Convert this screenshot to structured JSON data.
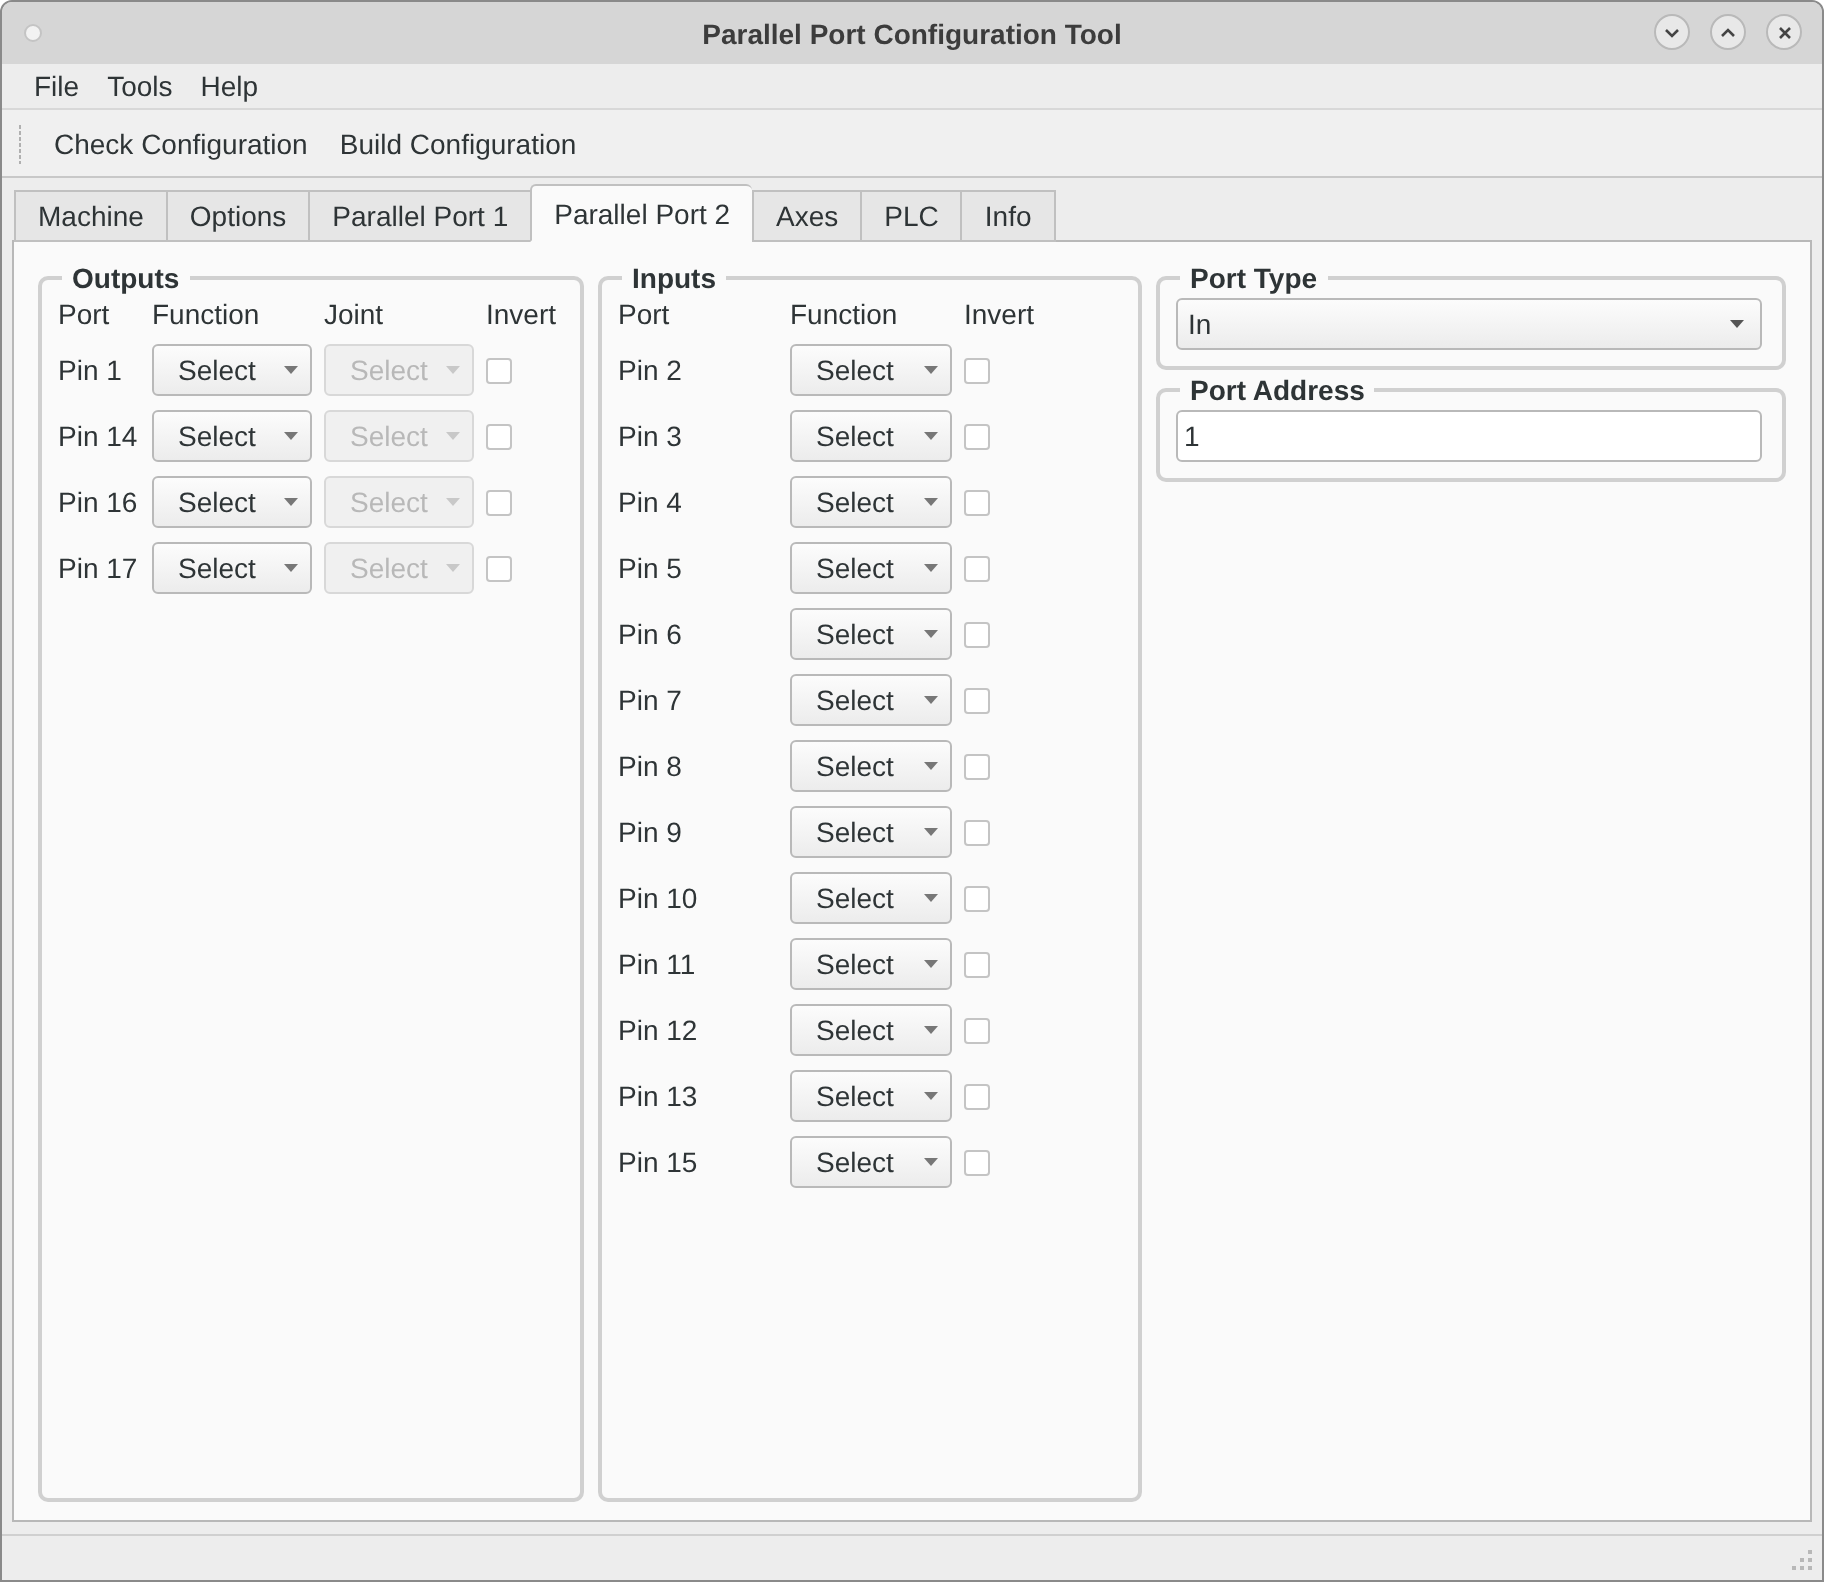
{
  "window": {
    "title": "Parallel Port Configuration Tool"
  },
  "menu": [
    "File",
    "Tools",
    "Help"
  ],
  "toolbar": [
    "Check Configuration",
    "Build Configuration"
  ],
  "tabs": [
    {
      "label": "Machine",
      "selected": false
    },
    {
      "label": "Options",
      "selected": false
    },
    {
      "label": "Parallel Port 1",
      "selected": false
    },
    {
      "label": "Parallel Port 2",
      "selected": true
    },
    {
      "label": "Axes",
      "selected": false
    },
    {
      "label": "PLC",
      "selected": false
    },
    {
      "label": "Info",
      "selected": false
    }
  ],
  "outputs": {
    "title": "Outputs",
    "columns": [
      "Port",
      "Function",
      "Joint",
      "Invert"
    ],
    "pins": [
      {
        "label": "Pin 1",
        "function": "Select",
        "joint": {
          "value": "Select",
          "disabled": true
        },
        "checked": false
      },
      {
        "label": "Pin 14",
        "function": "Select",
        "joint": {
          "value": "Select",
          "disabled": true
        },
        "checked": false
      },
      {
        "label": "Pin 16",
        "function": "Select",
        "joint": {
          "value": "Select",
          "disabled": true
        },
        "checked": false
      },
      {
        "label": "Pin 17",
        "function": "Select",
        "joint": {
          "value": "Select",
          "disabled": true
        },
        "checked": false
      }
    ]
  },
  "inputs": {
    "title": "Inputs",
    "columns": [
      "Port",
      "Function",
      "Invert"
    ],
    "pins": [
      {
        "label": "Pin 2",
        "function": "Select",
        "checked": false
      },
      {
        "label": "Pin 3",
        "function": "Select",
        "checked": false
      },
      {
        "label": "Pin 4",
        "function": "Select",
        "checked": false
      },
      {
        "label": "Pin 5",
        "function": "Select",
        "checked": false
      },
      {
        "label": "Pin 6",
        "function": "Select",
        "checked": false
      },
      {
        "label": "Pin 7",
        "function": "Select",
        "checked": false
      },
      {
        "label": "Pin 8",
        "function": "Select",
        "checked": false
      },
      {
        "label": "Pin 9",
        "function": "Select",
        "checked": false
      },
      {
        "label": "Pin 10",
        "function": "Select",
        "checked": false
      },
      {
        "label": "Pin 11",
        "function": "Select",
        "checked": false
      },
      {
        "label": "Pin 12",
        "function": "Select",
        "checked": false
      },
      {
        "label": "Pin 13",
        "function": "Select",
        "checked": false
      },
      {
        "label": "Pin 15",
        "function": "Select",
        "checked": false
      }
    ]
  },
  "port_type": {
    "title": "Port Type",
    "value": "In"
  },
  "port_address": {
    "title": "Port Address",
    "value": "1"
  }
}
